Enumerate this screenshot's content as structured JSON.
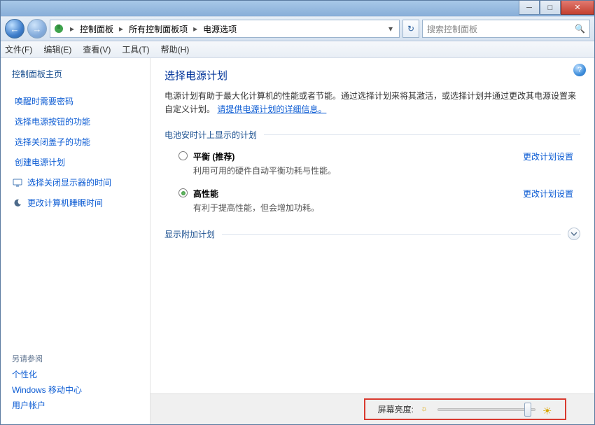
{
  "window": {
    "minimize_glyph": "─",
    "maximize_glyph": "□",
    "close_glyph": "✕"
  },
  "nav": {
    "back_glyph": "←",
    "forward_glyph": "→",
    "refresh_glyph": "↻",
    "dropdown_glyph": "▾"
  },
  "breadcrumb": {
    "sep": "▸",
    "item1": "控制面板",
    "item2": "所有控制面板项",
    "item3": "电源选项"
  },
  "search": {
    "placeholder": "搜索控制面板",
    "icon_glyph": "🔍"
  },
  "menubar": {
    "file": "文件(F)",
    "edit": "编辑(E)",
    "view": "查看(V)",
    "tools": "工具(T)",
    "help": "帮助(H)"
  },
  "sidebar": {
    "home": "控制面板主页",
    "links": {
      "l0": "唤醒时需要密码",
      "l1": "选择电源按钮的功能",
      "l2": "选择关闭盖子的功能",
      "l3": "创建电源计划"
    },
    "tasks": {
      "t0": {
        "label": "选择关闭显示器的时间",
        "icon": "🖵"
      },
      "t1": {
        "label": "更改计算机睡眠时间",
        "icon": "◐"
      }
    },
    "see_also": {
      "header": "另请参阅",
      "a0": "个性化",
      "a1": "Windows 移动中心",
      "a2": "用户帐户"
    }
  },
  "main": {
    "help_glyph": "?",
    "heading": "选择电源计划",
    "description": "电源计划有助于最大化计算机的性能或者节能。通过选择计划来将其激活，或选择计划并通过更改其电源设置来自定义计划。",
    "more_info": "请提供电源计划的详细信息。",
    "group_caption": "电池安时计上显示的计划",
    "plans": {
      "p0": {
        "name": "平衡 (推荐)",
        "desc": "利用可用的硬件自动平衡功耗与性能。",
        "change": "更改计划设置"
      },
      "p1": {
        "name": "高性能",
        "desc": "有利于提高性能，但会增加功耗。",
        "change": "更改计划设置"
      }
    },
    "show_more": "显示附加计划",
    "expand_glyph": "⌄"
  },
  "footer": {
    "brightness_label": "屏幕亮度:",
    "sun_low": "☼",
    "sun_high": "☀"
  }
}
